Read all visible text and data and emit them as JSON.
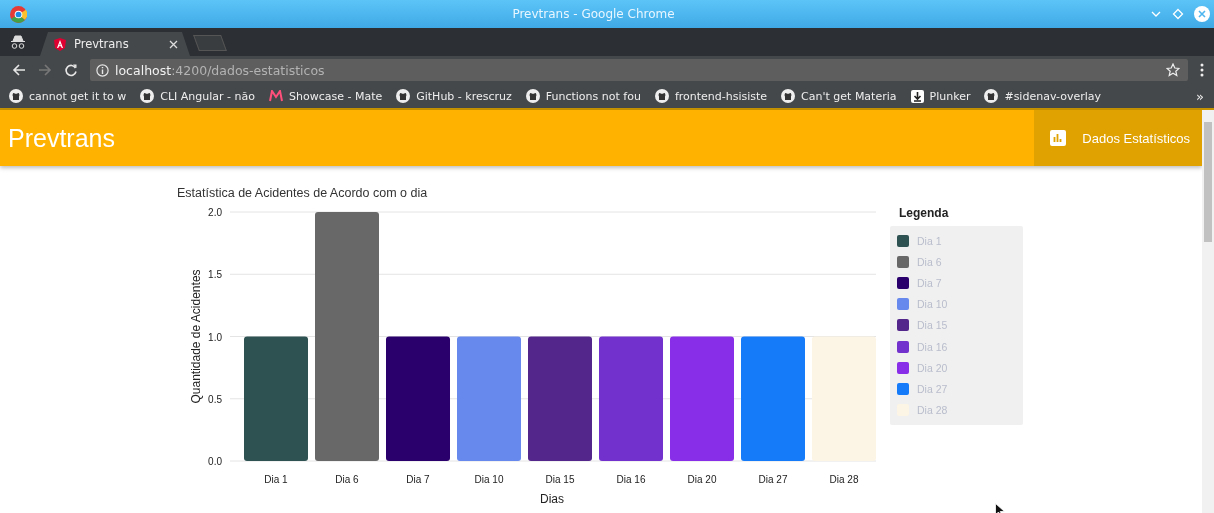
{
  "window": {
    "title": "Prevtrans - Google Chrome"
  },
  "tabs": [
    {
      "title": "Prevtrans",
      "selected": true
    }
  ],
  "address_bar": {
    "host": "localhost",
    "path": ":4200/dados-estatisticos"
  },
  "bookmarks": [
    {
      "title": "cannot get it to w",
      "kind": "github"
    },
    {
      "title": "CLI Angular - não",
      "kind": "github"
    },
    {
      "title": "Showcase - Mate",
      "kind": "material"
    },
    {
      "title": "GitHub - krescruz",
      "kind": "github"
    },
    {
      "title": "Functions not fou",
      "kind": "github"
    },
    {
      "title": "frontend-hsisiste",
      "kind": "github"
    },
    {
      "title": "Can't get Materia",
      "kind": "github"
    },
    {
      "title": "Plunker",
      "kind": "plunker"
    },
    {
      "title": "#sidenav-overlay",
      "kind": "github"
    }
  ],
  "bookmarks_more": "»",
  "toolbar": {
    "title": "Prevtrans",
    "nav_button": "Dados Estatísticos"
  },
  "chart": {
    "chart_data": {
      "type": "bar",
      "title": "Estatística de Acidentes de Acordo com o dia",
      "xlabel": "Dias",
      "ylabel": "Quantidade de Acidentes",
      "categories": [
        "Dia 1",
        "Dia 6",
        "Dia 7",
        "Dia 10",
        "Dia 15",
        "Dia 16",
        "Dia 20",
        "Dia 27",
        "Dia 28"
      ],
      "series": [
        {
          "values": [
            1,
            2,
            1,
            1,
            1,
            1,
            1,
            1,
            1
          ]
        }
      ],
      "grid": true,
      "ylim": [
        0,
        2
      ],
      "yticks": [
        {
          "value": 0,
          "label": "0.0"
        },
        {
          "value": 0.5,
          "label": "0.5"
        },
        {
          "value": 1,
          "label": "1.0"
        },
        {
          "value": 1.5,
          "label": "1.5"
        },
        {
          "value": 2,
          "label": "2.0"
        }
      ]
    }
  },
  "legend": {
    "title": "Legenda",
    "items": [
      {
        "label": "Dia 1",
        "color": "#2d5251"
      },
      {
        "label": "Dia 6",
        "color": "#686868"
      },
      {
        "label": "Dia 7",
        "color": "#2a006c"
      },
      {
        "label": "Dia 10",
        "color": "#6788ec"
      },
      {
        "label": "Dia 15",
        "color": "#52268a"
      },
      {
        "label": "Dia 16",
        "color": "#7231cc"
      },
      {
        "label": "Dia 20",
        "color": "#892ee8"
      },
      {
        "label": "Dia 27",
        "color": "#167bf8"
      },
      {
        "label": "Dia 28",
        "color": "#fcf4e4"
      }
    ]
  }
}
